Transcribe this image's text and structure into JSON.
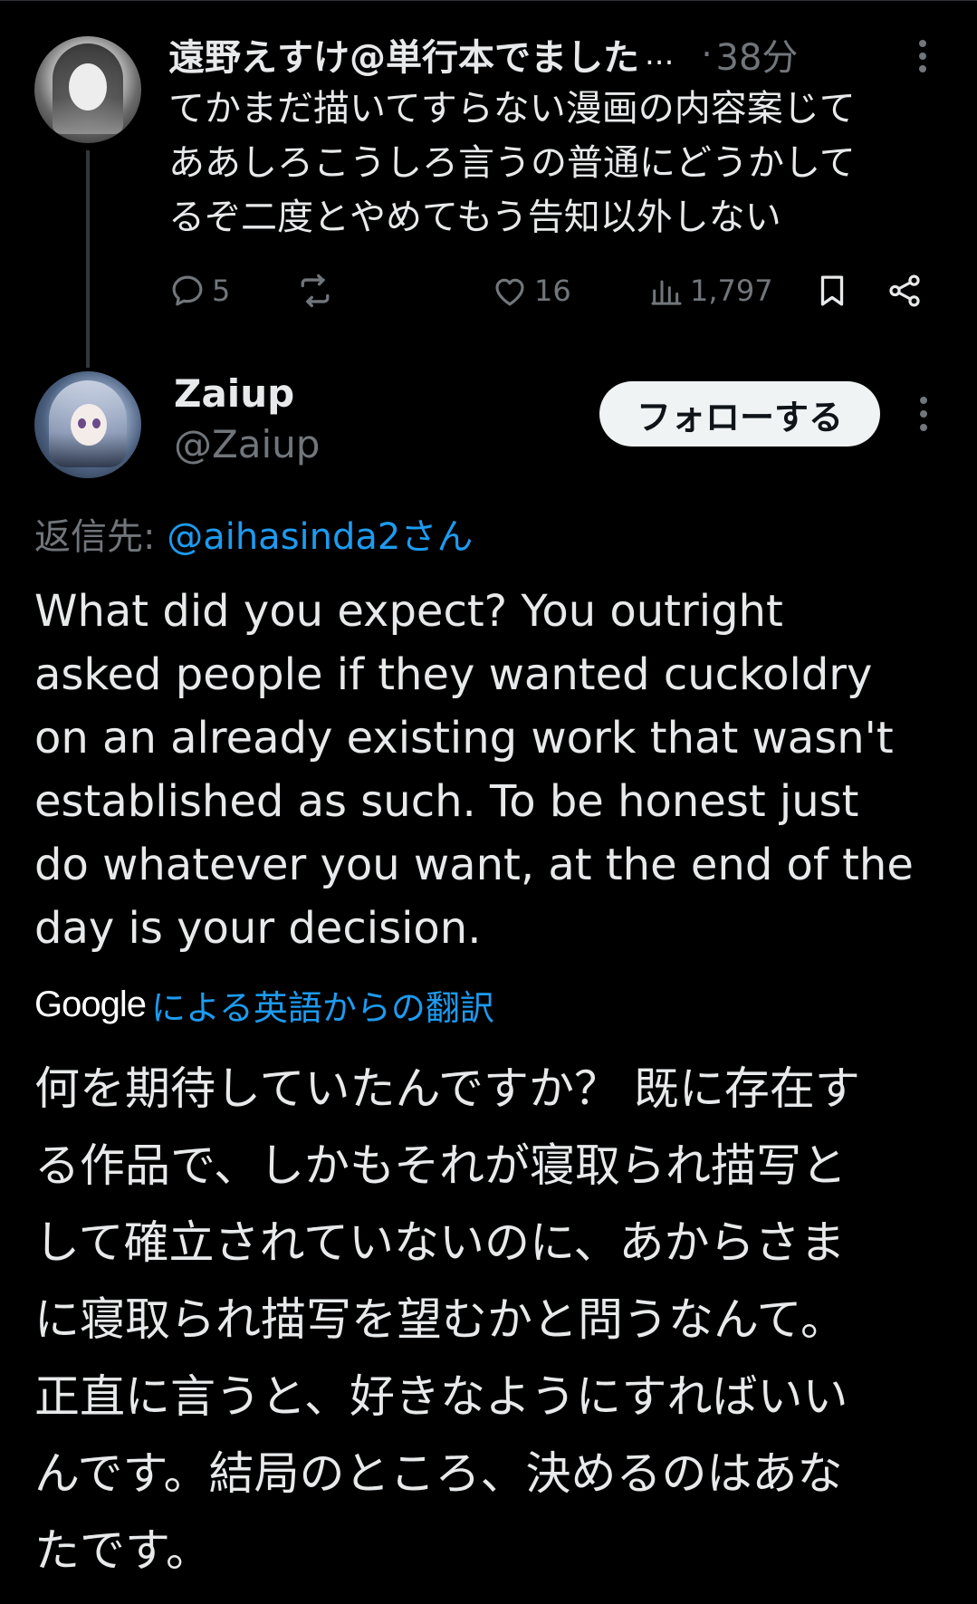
{
  "parent_tweet": {
    "display_name": "遠野えすけ@単行本でました",
    "ellipsis": "...",
    "dot": "·",
    "time": "38分",
    "text_lines": [
      "てかまだ描いてすらない漫画の内容案じて",
      "ああしろこうしろ言うの普通にどうかして",
      "るぞ二度とやめてもう告知以外しない"
    ],
    "actions": {
      "replies": "5",
      "likes": "16",
      "views": "1,797"
    }
  },
  "reply_tweet": {
    "display_name": "Zaiup",
    "handle": "@Zaiup",
    "follow_label": "フォローする",
    "replying_prefix": "返信先: ",
    "replying_mention": "@aihasinda2さん",
    "body_lines": [
      "What did you expect? You outright",
      "asked people if they wanted cuckoldry",
      "on an already existing work that wasn't",
      "established as such.  To be honest just",
      "do whatever you want, at the end of the",
      "day is your decision."
    ],
    "translation": {
      "provider": "Google",
      "label": "による英語からの翻訳"
    },
    "translated_lines": [
      "何を期待していたんですか？ 既に存在す",
      "る作品で、しかもそれが寝取られ描写と",
      "して確立されていないのに、あからさま",
      "に寝取られ描写を望むかと問うなんて。",
      "正直に言うと、好きなようにすればいい",
      "んです。結局のところ、決めるのはあな",
      "たです。"
    ]
  },
  "colors": {
    "background": "#000000",
    "text": "#e7e9ea",
    "secondary": "#71767b",
    "link": "#1d9bf0",
    "follow_button_bg": "#eff3f4"
  },
  "icons": [
    "more-vertical-icon",
    "reply-icon",
    "retweet-icon",
    "like-icon",
    "views-icon",
    "bookmark-icon",
    "share-icon"
  ]
}
